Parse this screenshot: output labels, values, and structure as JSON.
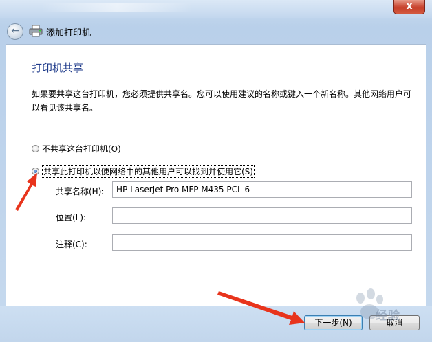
{
  "window": {
    "title": "添加打印机",
    "close_glyph": "x"
  },
  "nav": {
    "back_glyph": "←"
  },
  "content": {
    "heading": "打印机共享",
    "description": "如果要共享这台打印机，您必须提供共享名。您可以使用建议的名称或键入一个新名称。其他网络用户可以看见该共享名。",
    "option_no_share": "不共享这台打印机(O)",
    "option_share": "共享此打印机以便网络中的其他用户可以找到并使用它(S)",
    "share_selected": true,
    "fields": {
      "share_name_label": "共享名称(H):",
      "share_name_value": "HP LaserJet Pro MFP M435 PCL 6",
      "location_label": "位置(L):",
      "location_value": "",
      "comment_label": "注释(C):",
      "comment_value": ""
    }
  },
  "footer": {
    "next_button": "下一步(N)",
    "cancel_button": "取消"
  },
  "overlay": {
    "watermark_text": "经验",
    "arrow_color": "#e8341c"
  }
}
